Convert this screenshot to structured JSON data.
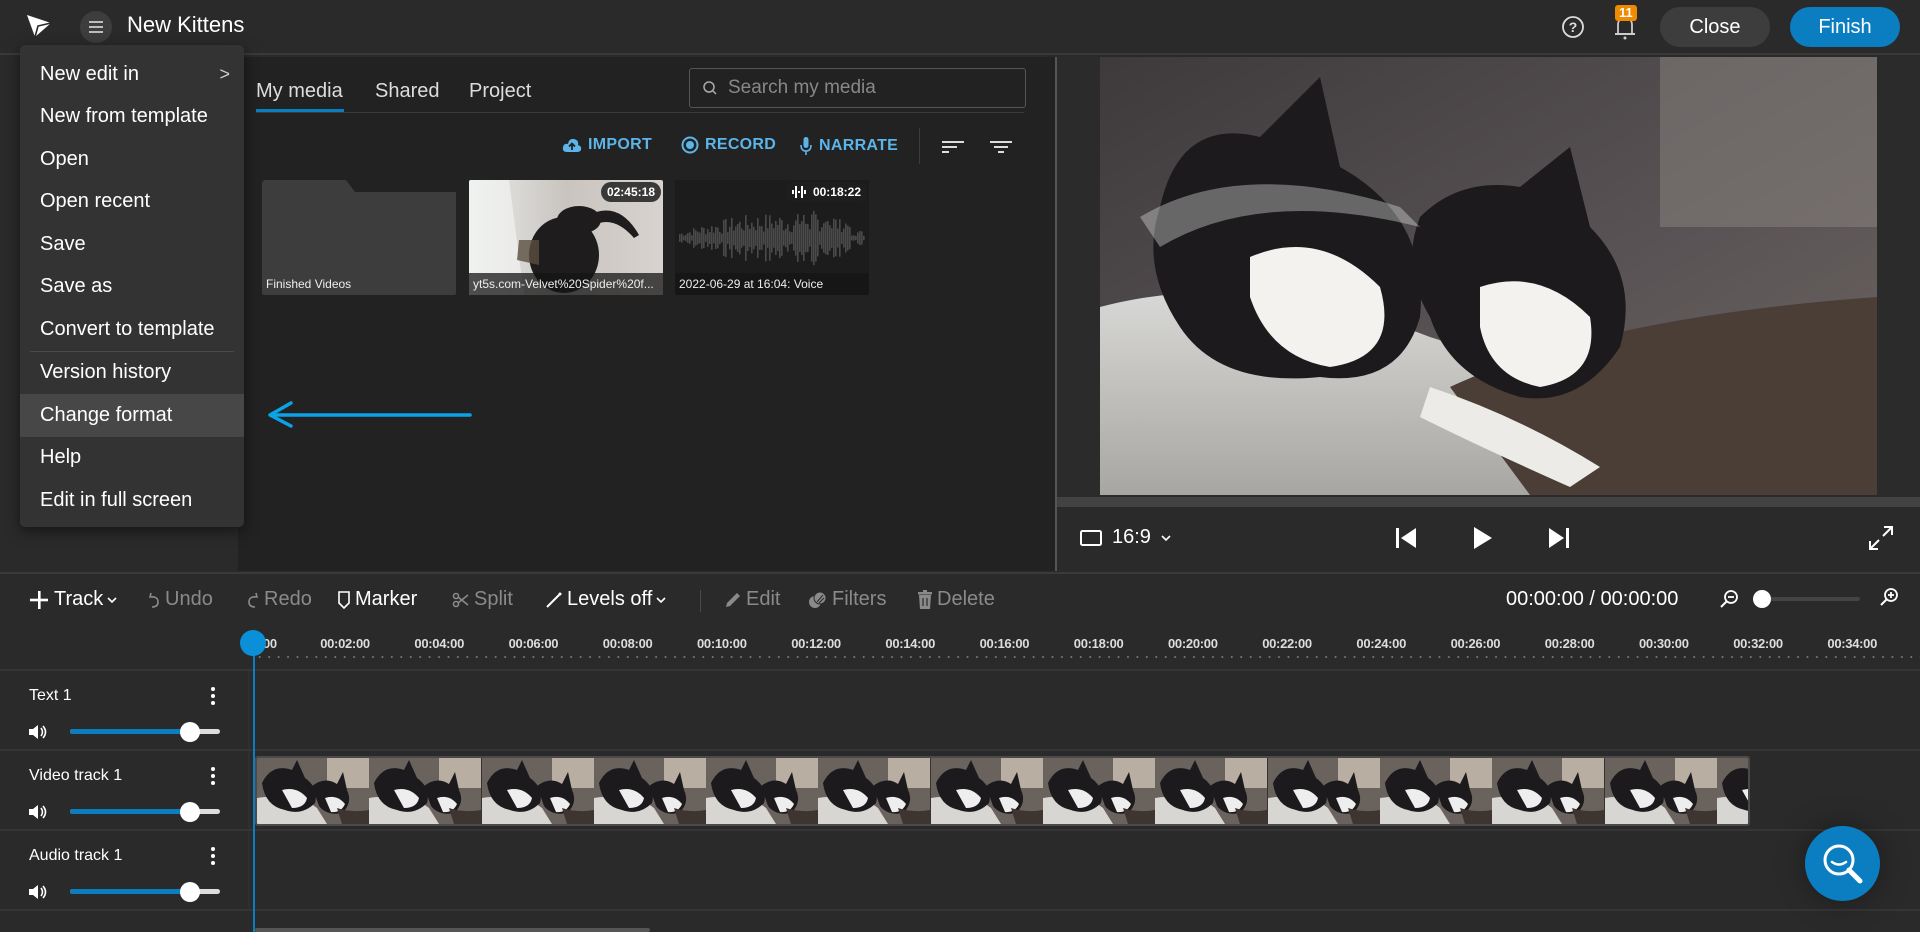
{
  "app": {
    "logo_icon": "app-logo-icon",
    "menu_icon": "hamburger-icon",
    "project_title": "New Kittens"
  },
  "header": {
    "help_icon": "help-circle-icon",
    "notifications_icon": "bell-icon",
    "notifications_count": "11",
    "close_label": "Close",
    "finish_label": "Finish",
    "accent_color": "#0b7dc1",
    "badge_color": "#f08a00"
  },
  "main_menu": {
    "items": [
      {
        "label": "New edit in",
        "has_submenu": true
      },
      {
        "label": "New from template"
      },
      {
        "label": "Open"
      },
      {
        "label": "Open recent"
      },
      {
        "label": "Save"
      },
      {
        "label": "Save as"
      },
      {
        "label": "Convert to template"
      },
      {
        "label": "Version history"
      },
      {
        "label": "Change format",
        "highlighted": true
      },
      {
        "label": "Help"
      },
      {
        "label": "Edit in full screen"
      }
    ],
    "submenu_indicator": ">"
  },
  "media_panel": {
    "tabs": [
      {
        "label": "My media",
        "active": true
      },
      {
        "label": "Shared"
      },
      {
        "label": "Project"
      }
    ],
    "search": {
      "placeholder": "Search my media",
      "value": ""
    },
    "actions": [
      {
        "label": "IMPORT",
        "icon": "cloud-upload-icon"
      },
      {
        "label": "RECORD",
        "icon": "record-icon"
      },
      {
        "label": "NARRATE",
        "icon": "microphone-icon"
      }
    ],
    "sort_icon": "sort-icon",
    "filter_icon": "filter-icon",
    "items": [
      {
        "type": "folder",
        "name": "Finished Videos"
      },
      {
        "type": "video",
        "name": "yt5s.com-Velvet%20Spider%20f...",
        "duration": "02:45:18"
      },
      {
        "type": "audio",
        "name": "2022-06-29 at 16:04: Voice",
        "duration": "00:18:22"
      }
    ],
    "annotation_arrow_color": "#0aa3e8"
  },
  "preview": {
    "aspect_ratio": "16:9",
    "controls": {
      "skip_back_icon": "skip-to-start-icon",
      "play_icon": "play-icon",
      "skip_forward_icon": "skip-to-end-icon",
      "fullscreen_icon": "fullscreen-icon"
    }
  },
  "timeline_toolbar": {
    "track": {
      "label": "Track",
      "enabled": true
    },
    "undo": {
      "label": "Undo",
      "enabled": false
    },
    "redo": {
      "label": "Redo",
      "enabled": false
    },
    "marker": {
      "label": "Marker",
      "enabled": true
    },
    "split": {
      "label": "Split",
      "enabled": false
    },
    "levels": {
      "label": "Levels off",
      "enabled": true
    },
    "edit": {
      "label": "Edit",
      "enabled": false
    },
    "filters": {
      "label": "Filters",
      "enabled": false
    },
    "delete": {
      "label": "Delete",
      "enabled": false
    },
    "timecode": "00:00:00 / 00:00:00",
    "zoom_level": 0
  },
  "ruler": {
    "ticks": [
      "00:00:00",
      "00:02:00",
      "00:04:00",
      "00:06:00",
      "00:08:00",
      "00:10:00",
      "00:12:00",
      "00:14:00",
      "00:16:00",
      "00:18:00",
      "00:20:00",
      "00:22:00",
      "00:24:00",
      "00:26:00",
      "00:28:00",
      "00:30:00",
      "00:32:00",
      "00:34:00"
    ],
    "first_tick_visible": "00"
  },
  "tracks": [
    {
      "name": "Text 1",
      "volume": 0.8
    },
    {
      "name": "Video track 1",
      "volume": 0.8,
      "clip_frames": 14
    },
    {
      "name": "Audio track 1",
      "volume": 0.8
    }
  ],
  "help_fab_icon": "search-help-icon"
}
